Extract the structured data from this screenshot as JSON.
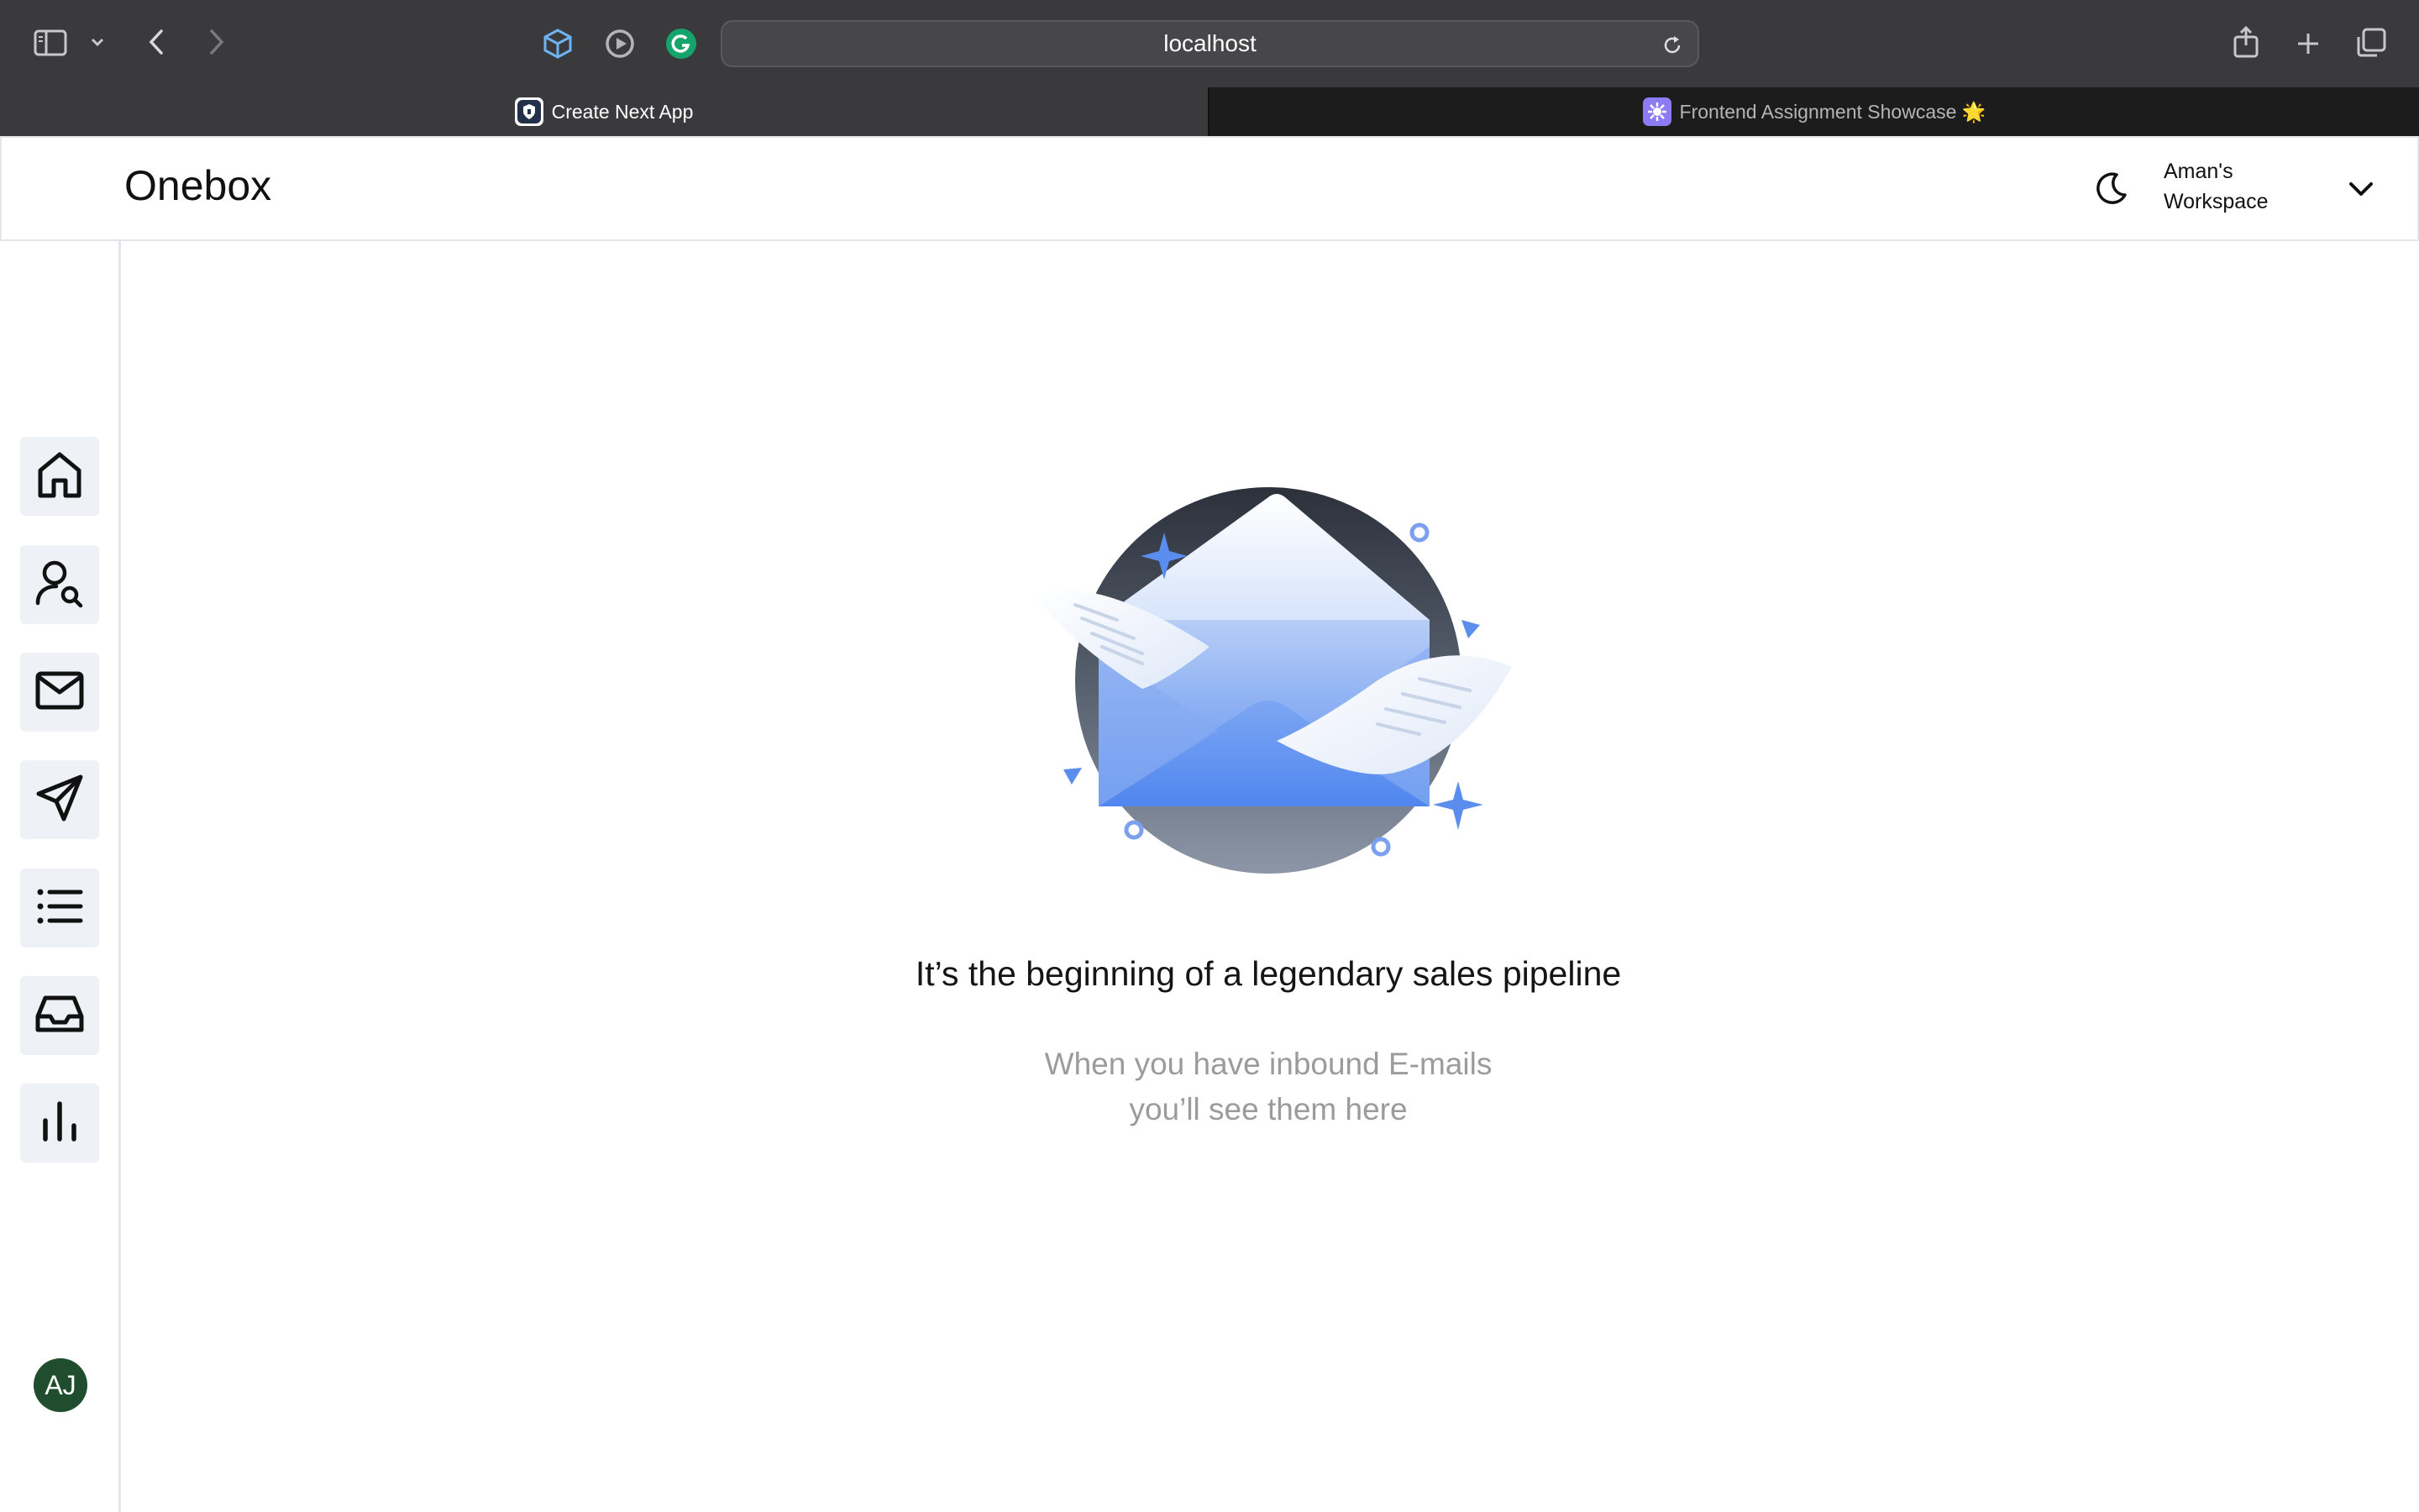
{
  "browser": {
    "url": "localhost",
    "icons": [
      "sidebar-toggle-icon",
      "chevron-down-icon",
      "back-icon",
      "forward-icon",
      "cube-extension-icon",
      "record-extension-icon",
      "grammarly-icon",
      "reload-icon",
      "share-icon",
      "new-tab-icon",
      "tab-overview-icon"
    ],
    "tabs": [
      {
        "title": "Create Next App",
        "active": true
      },
      {
        "title": "Frontend Assignment Showcase 🌟",
        "active": false
      }
    ]
  },
  "header": {
    "brand": "Onebox",
    "theme_icon": "moon-icon",
    "workspace": "Aman's Workspace",
    "workspace_icon": "chevron-down-icon"
  },
  "sidebar": {
    "items": [
      {
        "name": "home",
        "icon": "home-icon"
      },
      {
        "name": "user-search",
        "icon": "user-search-icon"
      },
      {
        "name": "mail",
        "icon": "mail-icon"
      },
      {
        "name": "send",
        "icon": "send-icon"
      },
      {
        "name": "list",
        "icon": "list-icon"
      },
      {
        "name": "inbox",
        "icon": "inbox-tray-icon"
      },
      {
        "name": "analytics",
        "icon": "bar-chart-icon"
      }
    ],
    "avatar_initials": "AJ"
  },
  "empty_state": {
    "illustration": "open-envelope-illustration",
    "headline": "It’s the beginning of a legendary sales pipeline",
    "subtext_line1": "When you have inbound E-mails",
    "subtext_line2": "you’ll see them here"
  },
  "colors": {
    "browser_toolbar": "#3a3a3c",
    "tab_inactive": "#1c1c1c",
    "nav_button_bg": "#eef1f6",
    "avatar_bg": "#1f4d2e",
    "illustration_blue": "#5b8def"
  }
}
